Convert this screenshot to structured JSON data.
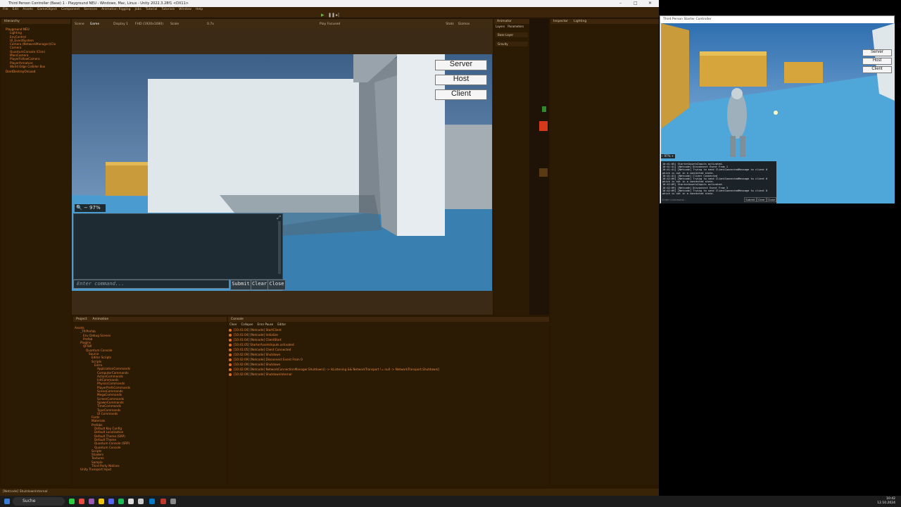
{
  "unity": {
    "title": "Third Person Controller (Base) 1 - Playground NEU - Windows, Mac, Linux - Unity 2022.3.28f1 <DX11>",
    "menu": [
      "File",
      "Edit",
      "Assets",
      "GameObject",
      "Component",
      "Services",
      "Animation Rigging",
      "Jobs",
      "Tutorial",
      "Tutorials",
      "Window",
      "Help"
    ],
    "hierarchy": {
      "tab": "Hierarchy",
      "root": "Playground NEU",
      "items": [
        "Lighting",
        "EnvControl",
        "UI_EventSystem",
        "Camera (NetworkManager)(Clo",
        "Camera",
        "QuantumConsole (Clon)",
        "MainCamera",
        "PlayerFollowCamera",
        "PlayerArmature",
        "World Edge Collider Box",
        "DontDestroyOnLoad"
      ]
    },
    "game": {
      "tabs": [
        "Scene",
        "Game"
      ],
      "display": "Display 1",
      "resolution": "FHD (1920x1080)",
      "scale_label": "Scale",
      "scale": "0.7x",
      "play_mode": "Play Focused",
      "stats": "Stats",
      "gizmos": "Gizmos",
      "buttons": {
        "server": "Server",
        "host": "Host",
        "client": "Client"
      },
      "overlay": {
        "zoom_label": "− 97% +",
        "placeholder": "Enter command...",
        "submit": "Submit",
        "clear": "Clear",
        "close": "Close"
      }
    },
    "animator": {
      "tab": "Animator",
      "sub": [
        "Layers",
        "Parameters"
      ],
      "items": [
        "Base Layer",
        "Gravity"
      ]
    },
    "inspector": {
      "tabs": [
        "Inspector",
        "Lighting"
      ]
    },
    "project": {
      "tabs": [
        "Project",
        "Animation"
      ],
      "items": [
        "Assets",
        "_TP/Prefab",
        "Env Debug Scenes",
        "Prefab",
        "Plugins",
        "QFSW",
        "Quantum Console",
        "Source",
        "Editor Scripts",
        "Scripts",
        "Extra",
        "ApplicationCommands",
        "ComputerCommands",
        "ActionCommands",
        "InitCommands",
        "PhysicsCommands",
        "PlayerPrefsCommands",
        "SceneCommands",
        "MegaCommands",
        "ScreenCommands",
        "SpawnCommands",
        "TimeCommands",
        "TypeCommands",
        "UI Commands",
        "Fonts",
        "Materials",
        "Prefabs",
        "Default Key Config",
        "Default Localization",
        "Default Theme (SRP)",
        "Default Theme",
        "Quantum Console (SRP)",
        "Quantum Console",
        "Scripts",
        "Shaders",
        "Textures",
        "Sample",
        "Third Party Notices",
        "Unity Transport Input"
      ]
    },
    "console": {
      "tab": "Console",
      "toolbar": [
        "Clear",
        "Collapse",
        "Error Pause",
        "Editor"
      ],
      "entries": [
        "[10:41:04] [Netcode] StartClient",
        "[10:41:04] [Netcode] Initialize",
        "[10:41:04] [Netcode] ClientStart",
        "[10:41:05] StarterAssetsInputs activated.",
        "[10:41:05] [Netcode] Client Connected",
        "[10:42:09] [Netcode] Shutdown",
        "[10:42:09] [Netcode] Disconnect Event From 0",
        "[10:42:09] [Netcode] Shutdown",
        "[10:42:09] [Netcode] NetworkConnectionManager.Shutdown() -> IsListening && NetworkTransport != null -> NetworkTransport.Shutdown()",
        "[10:42:09] [Netcode] ShutdownInternal"
      ]
    },
    "status": "[Netcode] ShutdownInternal"
  },
  "build_window": {
    "title": "Third Person Starter Controller",
    "buttons": {
      "server": "Server",
      "host": "Host",
      "client": "Client"
    },
    "zoom": "− 97% +",
    "log": [
      "10:41:05] StarterAssetsInputs activated.",
      "10:41:41] [Netcode] Disconnect Event From 1",
      "10:41:41] [Netcode] Trying to send ClientConnectedMessage to client 0",
      "which is not in a connected state.",
      "10:41:41] [Netcode] Client Connected",
      "10:42:09] [Netcode] Trying to send ClientConnectedMessage to client 0",
      "which is not in a connected state.",
      "10:42:09] StarterAssetsInputs activated.",
      "10:42:09] [Netcode] Disconnect Event From 3",
      "10:42:09] [Netcode] Trying to send ClientConnectedMessage to client 0",
      "which is not in a connected state."
    ],
    "placeholder": "Enter command...",
    "submit": "Submit",
    "clear": "Clear",
    "close": "Close"
  },
  "taskbar": {
    "search": "Suche",
    "time": "10:42",
    "date": "12.10.2024"
  }
}
